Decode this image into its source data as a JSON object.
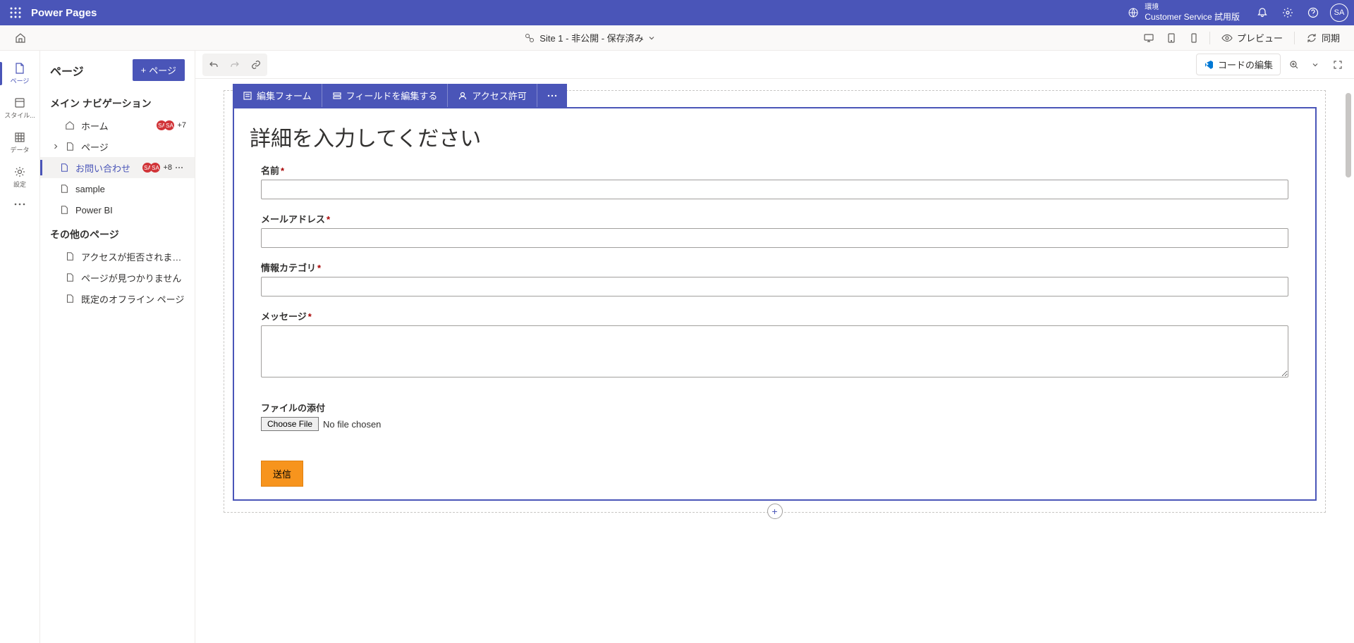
{
  "header": {
    "appTitle": "Power Pages",
    "envLabel": "環境",
    "envName": "Customer Service 試用版",
    "avatar": "SA"
  },
  "subheader": {
    "siteText": "Site 1 - 非公開 - 保存済み",
    "preview": "プレビュー",
    "sync": "同期"
  },
  "rail": {
    "pages": "ページ",
    "styles": "スタイル...",
    "data": "データ",
    "settings": "設定"
  },
  "sidebar": {
    "title": "ページ",
    "addPage": "ページ",
    "mainNavLabel": "メイン ナビゲーション",
    "otherPagesLabel": "その他のページ",
    "items": {
      "home": "ホーム",
      "pages": "ページ",
      "contact": "お問い合わせ",
      "sample": "sample",
      "powerbi": "Power BI"
    },
    "badges": {
      "homeCount": "+7",
      "contactCount": "+8"
    },
    "other": {
      "denied": "アクセスが拒否されました",
      "notfound": "ページが見つかりません",
      "offline": "既定のオフライン ページ"
    }
  },
  "toolbar": {
    "codeEdit": "コードの編集"
  },
  "formToolbar": {
    "editForm": "編集フォーム",
    "editFields": "フィールドを編集する",
    "access": "アクセス許可"
  },
  "form": {
    "title": "詳細を入力してください",
    "name": "名前",
    "email": "メールアドレス",
    "category": "情報カテゴリ",
    "message": "メッセージ",
    "attachment": "ファイルの添付",
    "chooseFile": "Choose File",
    "noFile": "No file chosen",
    "submit": "送信"
  }
}
